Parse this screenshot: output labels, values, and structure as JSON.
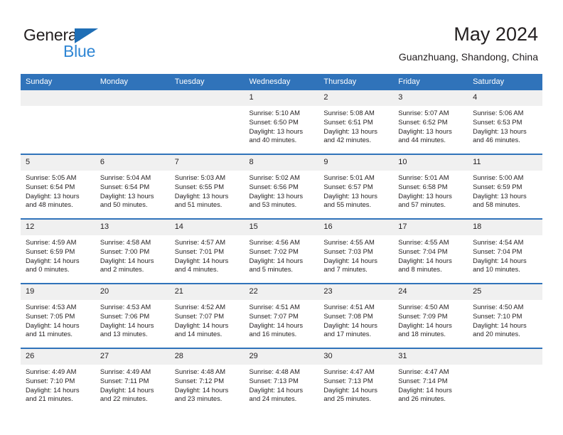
{
  "brand": {
    "name_top": "General",
    "name_bottom": "Blue",
    "triangle_color": "#1f6eb5",
    "blue_color": "#2f86d4"
  },
  "header": {
    "title": "May 2024",
    "subtitle": "Guanzhuang, Shandong, China"
  },
  "theme": {
    "header_bg": "#3073ba",
    "daynum_bg": "#f0f0f0",
    "text": "#231f20"
  },
  "weekdays": [
    "Sunday",
    "Monday",
    "Tuesday",
    "Wednesday",
    "Thursday",
    "Friday",
    "Saturday"
  ],
  "weeks": [
    [
      {
        "day": "",
        "empty": true
      },
      {
        "day": "",
        "empty": true
      },
      {
        "day": "",
        "empty": true
      },
      {
        "day": "1",
        "sunrise": "Sunrise: 5:10 AM",
        "sunset": "Sunset: 6:50 PM",
        "daylight": "Daylight: 13 hours and 40 minutes."
      },
      {
        "day": "2",
        "sunrise": "Sunrise: 5:08 AM",
        "sunset": "Sunset: 6:51 PM",
        "daylight": "Daylight: 13 hours and 42 minutes."
      },
      {
        "day": "3",
        "sunrise": "Sunrise: 5:07 AM",
        "sunset": "Sunset: 6:52 PM",
        "daylight": "Daylight: 13 hours and 44 minutes."
      },
      {
        "day": "4",
        "sunrise": "Sunrise: 5:06 AM",
        "sunset": "Sunset: 6:53 PM",
        "daylight": "Daylight: 13 hours and 46 minutes."
      }
    ],
    [
      {
        "day": "5",
        "sunrise": "Sunrise: 5:05 AM",
        "sunset": "Sunset: 6:54 PM",
        "daylight": "Daylight: 13 hours and 48 minutes."
      },
      {
        "day": "6",
        "sunrise": "Sunrise: 5:04 AM",
        "sunset": "Sunset: 6:54 PM",
        "daylight": "Daylight: 13 hours and 50 minutes."
      },
      {
        "day": "7",
        "sunrise": "Sunrise: 5:03 AM",
        "sunset": "Sunset: 6:55 PM",
        "daylight": "Daylight: 13 hours and 51 minutes."
      },
      {
        "day": "8",
        "sunrise": "Sunrise: 5:02 AM",
        "sunset": "Sunset: 6:56 PM",
        "daylight": "Daylight: 13 hours and 53 minutes."
      },
      {
        "day": "9",
        "sunrise": "Sunrise: 5:01 AM",
        "sunset": "Sunset: 6:57 PM",
        "daylight": "Daylight: 13 hours and 55 minutes."
      },
      {
        "day": "10",
        "sunrise": "Sunrise: 5:01 AM",
        "sunset": "Sunset: 6:58 PM",
        "daylight": "Daylight: 13 hours and 57 minutes."
      },
      {
        "day": "11",
        "sunrise": "Sunrise: 5:00 AM",
        "sunset": "Sunset: 6:59 PM",
        "daylight": "Daylight: 13 hours and 58 minutes."
      }
    ],
    [
      {
        "day": "12",
        "sunrise": "Sunrise: 4:59 AM",
        "sunset": "Sunset: 6:59 PM",
        "daylight": "Daylight: 14 hours and 0 minutes."
      },
      {
        "day": "13",
        "sunrise": "Sunrise: 4:58 AM",
        "sunset": "Sunset: 7:00 PM",
        "daylight": "Daylight: 14 hours and 2 minutes."
      },
      {
        "day": "14",
        "sunrise": "Sunrise: 4:57 AM",
        "sunset": "Sunset: 7:01 PM",
        "daylight": "Daylight: 14 hours and 4 minutes."
      },
      {
        "day": "15",
        "sunrise": "Sunrise: 4:56 AM",
        "sunset": "Sunset: 7:02 PM",
        "daylight": "Daylight: 14 hours and 5 minutes."
      },
      {
        "day": "16",
        "sunrise": "Sunrise: 4:55 AM",
        "sunset": "Sunset: 7:03 PM",
        "daylight": "Daylight: 14 hours and 7 minutes."
      },
      {
        "day": "17",
        "sunrise": "Sunrise: 4:55 AM",
        "sunset": "Sunset: 7:04 PM",
        "daylight": "Daylight: 14 hours and 8 minutes."
      },
      {
        "day": "18",
        "sunrise": "Sunrise: 4:54 AM",
        "sunset": "Sunset: 7:04 PM",
        "daylight": "Daylight: 14 hours and 10 minutes."
      }
    ],
    [
      {
        "day": "19",
        "sunrise": "Sunrise: 4:53 AM",
        "sunset": "Sunset: 7:05 PM",
        "daylight": "Daylight: 14 hours and 11 minutes."
      },
      {
        "day": "20",
        "sunrise": "Sunrise: 4:53 AM",
        "sunset": "Sunset: 7:06 PM",
        "daylight": "Daylight: 14 hours and 13 minutes."
      },
      {
        "day": "21",
        "sunrise": "Sunrise: 4:52 AM",
        "sunset": "Sunset: 7:07 PM",
        "daylight": "Daylight: 14 hours and 14 minutes."
      },
      {
        "day": "22",
        "sunrise": "Sunrise: 4:51 AM",
        "sunset": "Sunset: 7:07 PM",
        "daylight": "Daylight: 14 hours and 16 minutes."
      },
      {
        "day": "23",
        "sunrise": "Sunrise: 4:51 AM",
        "sunset": "Sunset: 7:08 PM",
        "daylight": "Daylight: 14 hours and 17 minutes."
      },
      {
        "day": "24",
        "sunrise": "Sunrise: 4:50 AM",
        "sunset": "Sunset: 7:09 PM",
        "daylight": "Daylight: 14 hours and 18 minutes."
      },
      {
        "day": "25",
        "sunrise": "Sunrise: 4:50 AM",
        "sunset": "Sunset: 7:10 PM",
        "daylight": "Daylight: 14 hours and 20 minutes."
      }
    ],
    [
      {
        "day": "26",
        "sunrise": "Sunrise: 4:49 AM",
        "sunset": "Sunset: 7:10 PM",
        "daylight": "Daylight: 14 hours and 21 minutes."
      },
      {
        "day": "27",
        "sunrise": "Sunrise: 4:49 AM",
        "sunset": "Sunset: 7:11 PM",
        "daylight": "Daylight: 14 hours and 22 minutes."
      },
      {
        "day": "28",
        "sunrise": "Sunrise: 4:48 AM",
        "sunset": "Sunset: 7:12 PM",
        "daylight": "Daylight: 14 hours and 23 minutes."
      },
      {
        "day": "29",
        "sunrise": "Sunrise: 4:48 AM",
        "sunset": "Sunset: 7:13 PM",
        "daylight": "Daylight: 14 hours and 24 minutes."
      },
      {
        "day": "30",
        "sunrise": "Sunrise: 4:47 AM",
        "sunset": "Sunset: 7:13 PM",
        "daylight": "Daylight: 14 hours and 25 minutes."
      },
      {
        "day": "31",
        "sunrise": "Sunrise: 4:47 AM",
        "sunset": "Sunset: 7:14 PM",
        "daylight": "Daylight: 14 hours and 26 minutes."
      },
      {
        "day": "",
        "empty": true
      }
    ]
  ]
}
